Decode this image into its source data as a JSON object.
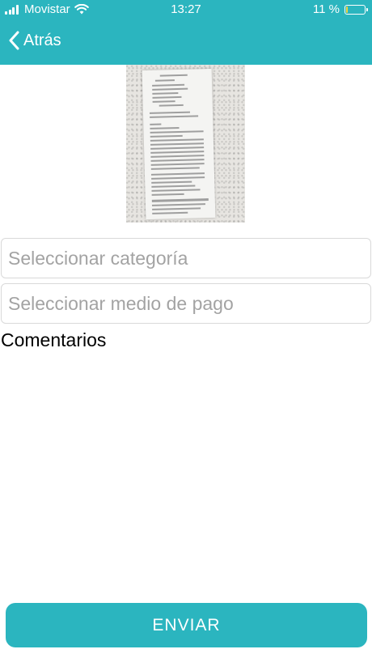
{
  "status_bar": {
    "carrier": "Movistar",
    "time": "13:27",
    "battery_text": "11 %",
    "battery_level": 0.11,
    "battery_color": "#f5d33a",
    "icons": [
      "signal-icon",
      "wifi-icon",
      "battery-icon"
    ]
  },
  "nav": {
    "back_label": "Atrás",
    "back_icon": "chevron-left-icon",
    "accent_color": "#2bb5bf"
  },
  "form": {
    "category_placeholder": "Seleccionar categoría",
    "payment_placeholder": "Seleccionar medio de pago",
    "comments_label": "Comentarios"
  },
  "footer": {
    "submit_label": "ENVIAR"
  }
}
